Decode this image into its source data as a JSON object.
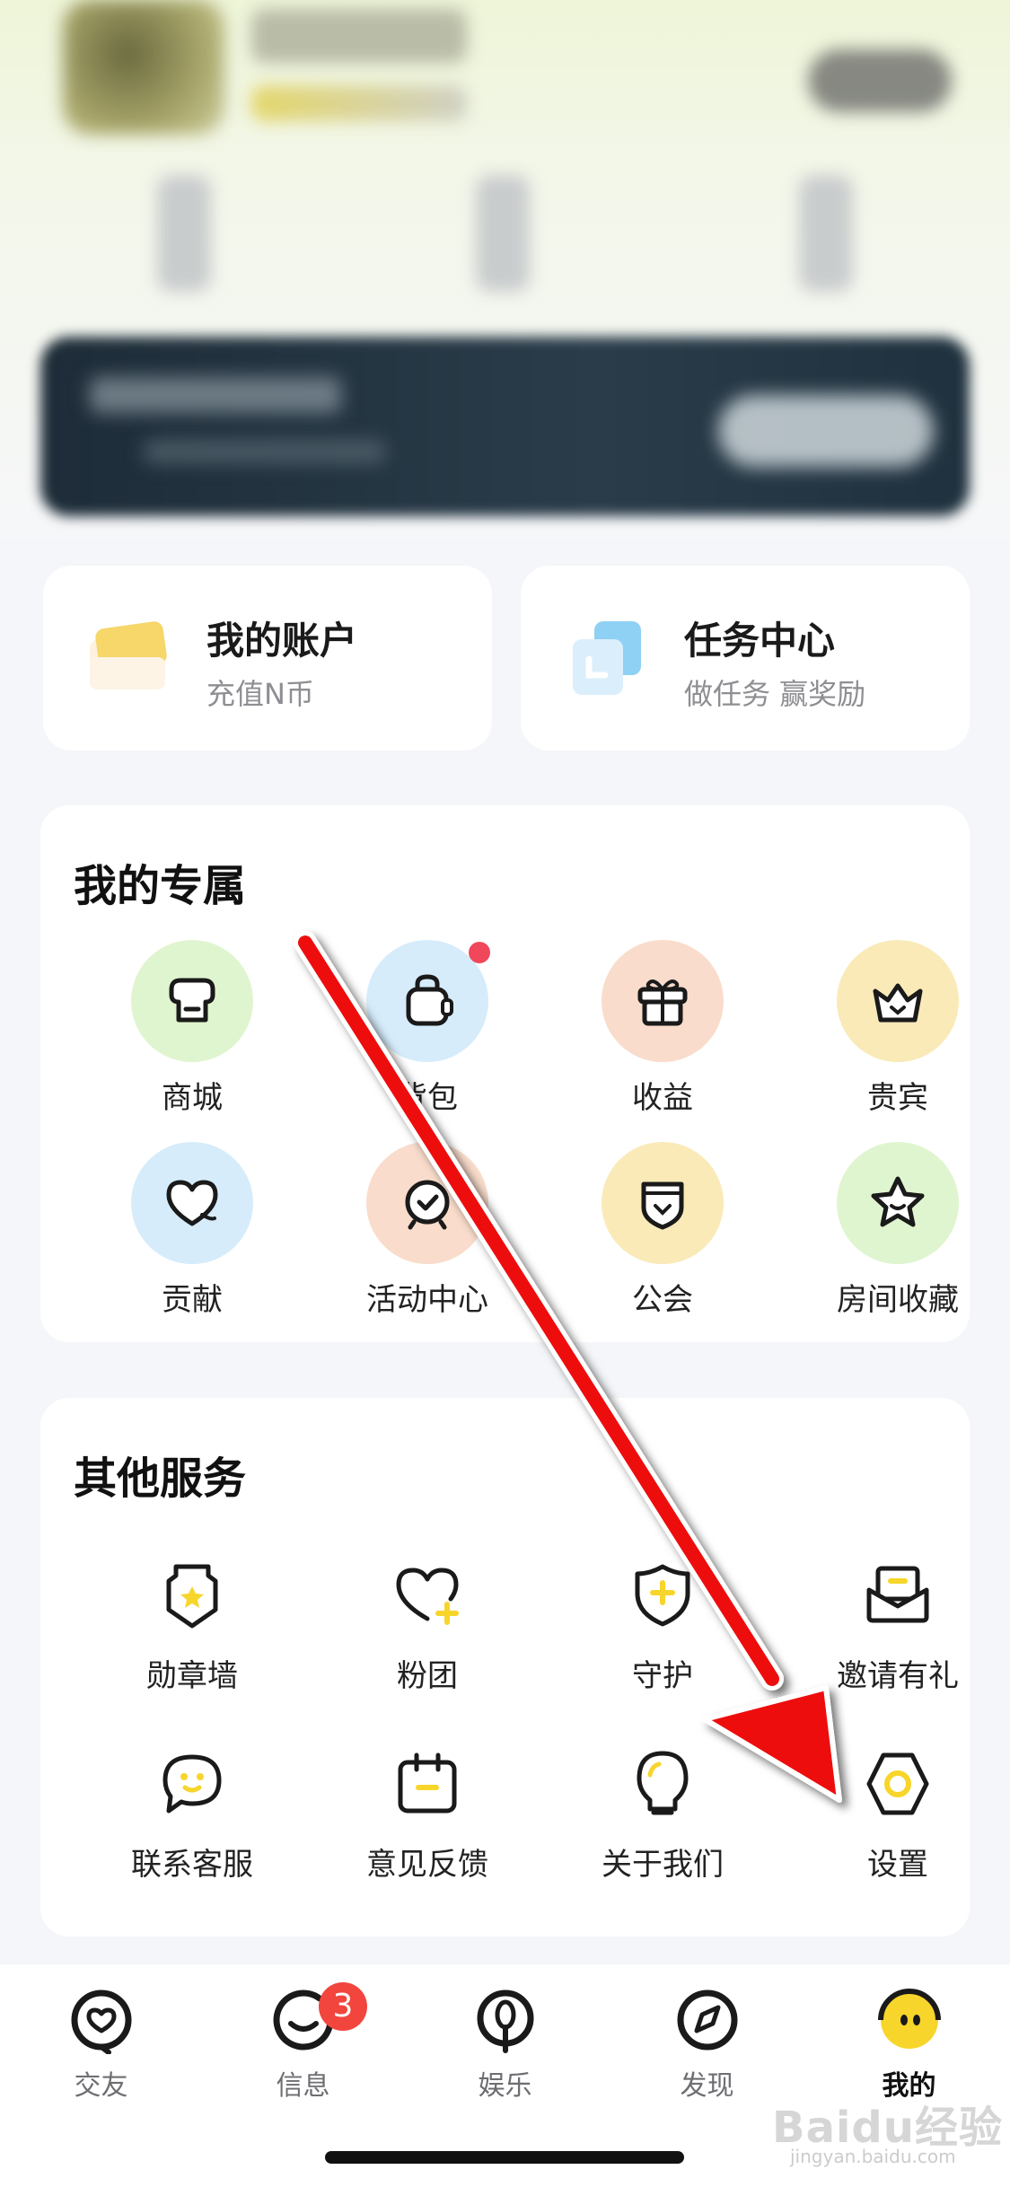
{
  "colors": {
    "accent_yellow": "#f7d52a",
    "badge_red": "#f2453d",
    "arrow_red": "#ee1111",
    "green_circle": "#dff5cf",
    "blue_circle": "#d6ecfb",
    "peach_circle": "#f9dccb",
    "yellow_circle": "#f9eab8"
  },
  "quick_cards": [
    {
      "title": "我的账户",
      "subtitle": "充值N币",
      "icon": "wallet-card-icon"
    },
    {
      "title": "任务中心",
      "subtitle": "做任务 赢奖励",
      "icon": "task-docs-icon"
    }
  ],
  "exclusive": {
    "title": "我的专属",
    "items": [
      {
        "label": "商城",
        "icon": "shop-icon"
      },
      {
        "label": "背包",
        "icon": "backpack-icon"
      },
      {
        "label": "收益",
        "icon": "gift-box-icon"
      },
      {
        "label": "贵宾",
        "icon": "crown-icon"
      },
      {
        "label": "贡献",
        "icon": "heart-icon"
      },
      {
        "label": "活动中心",
        "icon": "activity-clock-icon"
      },
      {
        "label": "公会",
        "icon": "guild-badge-icon"
      },
      {
        "label": "房间收藏",
        "icon": "star-icon"
      }
    ]
  },
  "services": {
    "title": "其他服务",
    "items": [
      {
        "label": "勋章墙",
        "icon": "medal-icon"
      },
      {
        "label": "粉团",
        "icon": "fan-heart-icon"
      },
      {
        "label": "守护",
        "icon": "shield-icon"
      },
      {
        "label": "邀请有礼",
        "icon": "invite-envelope-icon"
      },
      {
        "label": "联系客服",
        "icon": "chat-bubble-icon"
      },
      {
        "label": "意见反馈",
        "icon": "feedback-calendar-icon"
      },
      {
        "label": "关于我们",
        "icon": "lightbulb-icon"
      },
      {
        "label": "设置",
        "icon": "settings-hexagon-icon"
      }
    ]
  },
  "tabbar": {
    "tabs": [
      {
        "label": "交友",
        "icon": "friends-icon",
        "active": false
      },
      {
        "label": "信息",
        "icon": "message-smile-icon",
        "active": false,
        "badge": "3"
      },
      {
        "label": "娱乐",
        "icon": "entertainment-icon",
        "active": false
      },
      {
        "label": "发现",
        "icon": "compass-icon",
        "active": false
      },
      {
        "label": "我的",
        "icon": "profile-face-icon",
        "active": true
      }
    ]
  },
  "watermark": {
    "text": "Baidu经验",
    "sub": "jingyan.baidu.com"
  }
}
